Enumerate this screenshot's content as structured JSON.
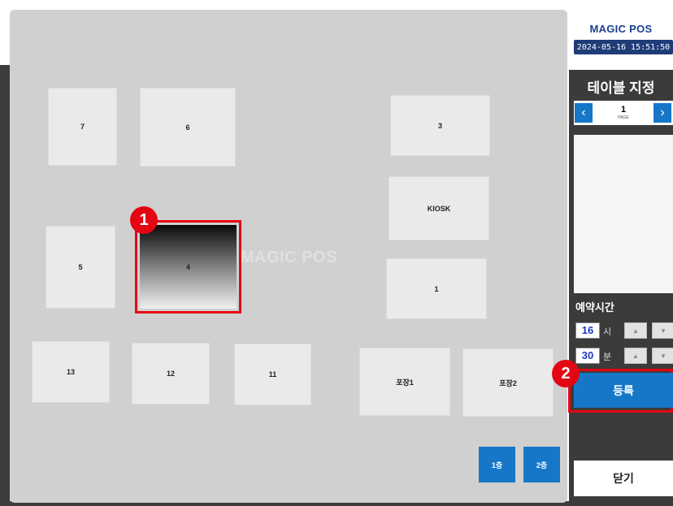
{
  "floor": {
    "watermark": "MAGIC POS",
    "tables": [
      {
        "name": "7"
      },
      {
        "name": "6"
      },
      {
        "name": "3"
      },
      {
        "name": "KIOSK"
      },
      {
        "name": "5"
      },
      {
        "name": "4",
        "selected": true
      },
      {
        "name": "1"
      },
      {
        "name": "13"
      },
      {
        "name": "12"
      },
      {
        "name": "11"
      },
      {
        "name": "포장1"
      },
      {
        "name": "포장2"
      }
    ],
    "floor_buttons": [
      "1층",
      "2층"
    ]
  },
  "badges": [
    "1",
    "2"
  ],
  "side": {
    "logo": "MAGIC POS",
    "datetime": "2024-05-16 15:51:50",
    "title": "테이블 지정",
    "pager": {
      "prev_icon": "chevron-left-icon",
      "next_icon": "chevron-right-icon",
      "page": "1",
      "page_word": "PAGE"
    },
    "reservation_label": "예약시간",
    "hour": {
      "value": "16",
      "unit": "시"
    },
    "minute": {
      "value": "30",
      "unit": "분"
    },
    "register_label": "등록",
    "close_label": "닫기"
  },
  "colors": {
    "accent": "#1677c9",
    "highlight": "#e30613",
    "floor": "#d0d0d0",
    "panel": "#3b3b3b"
  }
}
